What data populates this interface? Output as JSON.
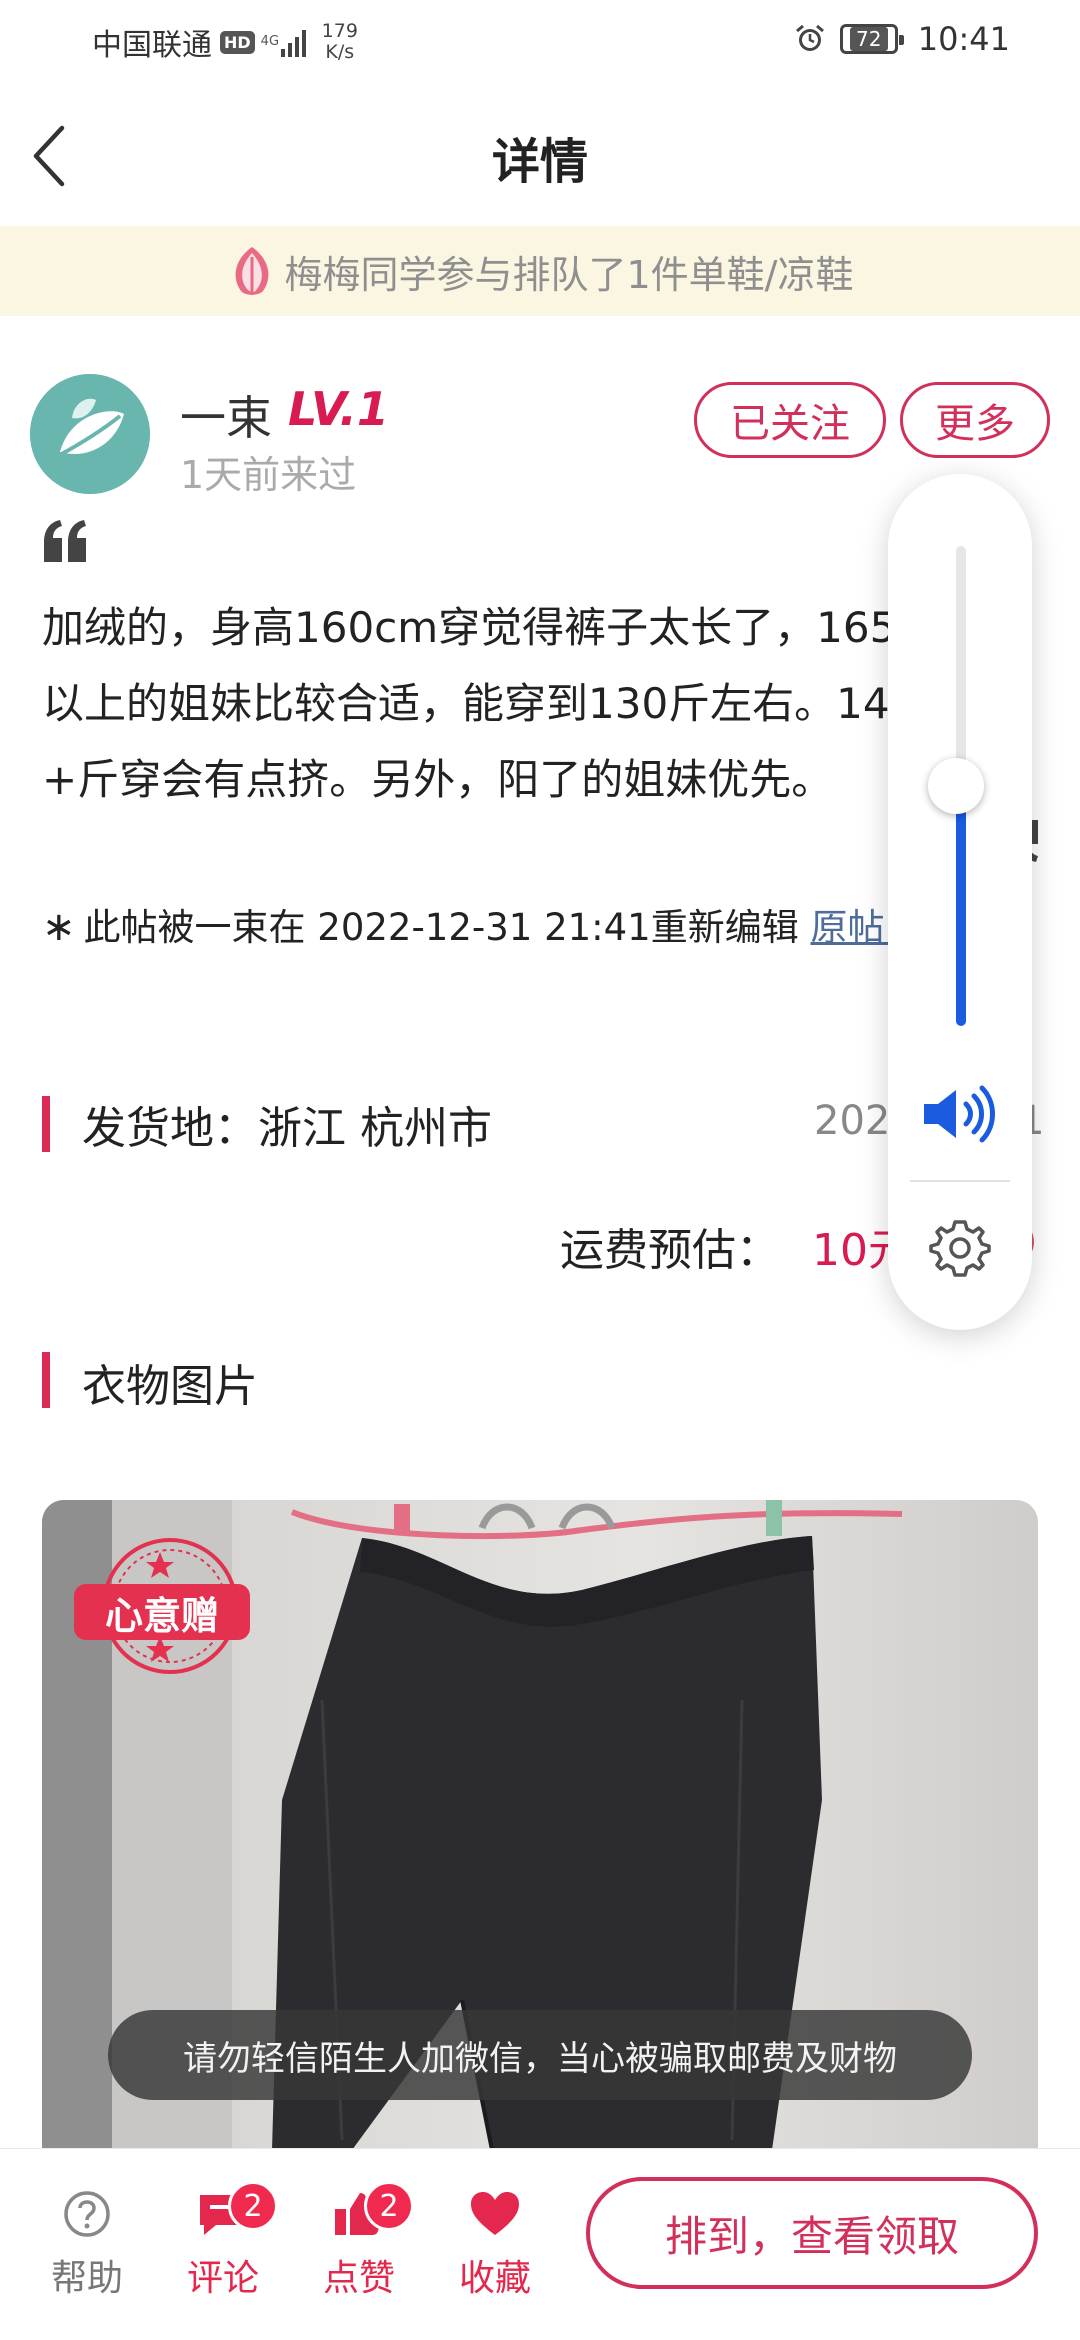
{
  "status_bar": {
    "carrier": "中国联通",
    "hd": "HD",
    "network": "4G",
    "speed_value": "179",
    "speed_unit": "K/s",
    "battery": "72",
    "time": "10:41"
  },
  "nav": {
    "title": "详情",
    "back_icon": "chevron-left-icon"
  },
  "banner": {
    "icon": "leaf-icon",
    "text": "梅梅同学参与排队了1件单鞋/凉鞋"
  },
  "user": {
    "name": "一束",
    "level": "LV.1",
    "last_seen": "1天前来过",
    "follow_label": "已关注",
    "more_label": "更多"
  },
  "post": {
    "body": "加绒的，身高160cm穿觉得裤子太长了，165\n以上的姐妹比较合适，能穿到130斤左右。140\n+斤穿会有点挤。另外，阳了的姐妹优先。",
    "edit_star": "∗",
    "edit_note": "此帖被一束在 2022-12-31 21:41重新编辑",
    "original_link": "原帖内容"
  },
  "shipping": {
    "label": "发货地：浙江 杭州市",
    "date": "2022/12/31",
    "freight_label": "运费预估：",
    "freight_value": "10元",
    "help": "?"
  },
  "photos": {
    "heading": "衣物图片",
    "badge": "心意赠"
  },
  "toast": {
    "text": "请勿轻信陌生人加微信，当心被骗取邮费及财物"
  },
  "volume": {
    "level_percent": 50,
    "icons": [
      "speaker-icon",
      "settings-icon"
    ]
  },
  "bottom_bar": {
    "help_label": "帮助",
    "comment_label": "评论",
    "comment_count": "2",
    "like_label": "点赞",
    "like_count": "2",
    "favorite_label": "收藏",
    "cta_label": "排到，查看领取"
  },
  "colors": {
    "accent": "#d2305a",
    "banner_bg": "#fbf6e2",
    "volume_blue": "#1a5be0"
  }
}
